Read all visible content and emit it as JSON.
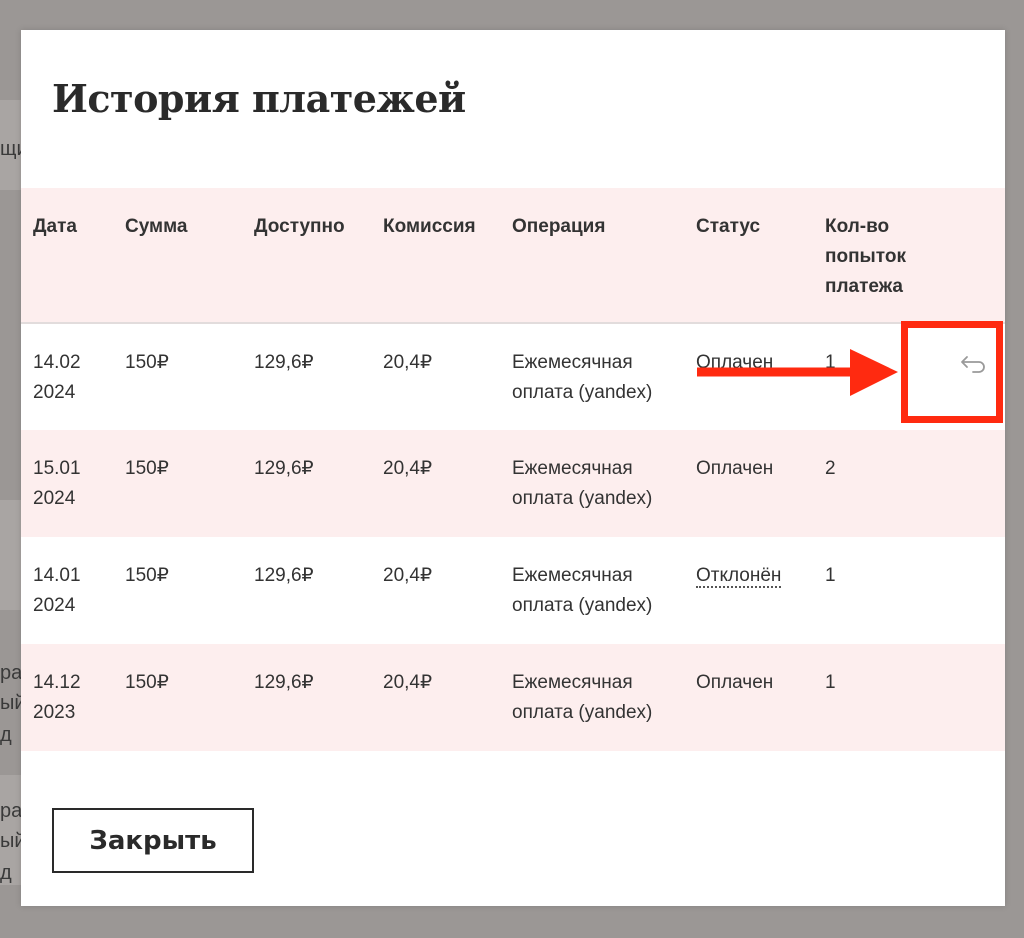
{
  "background": {
    "fragments": [
      "щи",
      "ра",
      "ый",
      "д",
      "ра",
      "ый",
      "д"
    ]
  },
  "modal": {
    "title": "История платежей",
    "close_label": "Закрыть"
  },
  "table": {
    "columns": [
      "Дата",
      "Сумма",
      "Доступно",
      "Комиссия",
      "Операция",
      "Статус",
      "Кол-во попыток платежа"
    ],
    "rows": [
      {
        "date": "14.02 2024",
        "amount": "150₽",
        "available": "129,6₽",
        "fee": "20,4₽",
        "operation": "Ежемесячная оплата (yandex)",
        "status": "Оплачен",
        "attempts": "1",
        "refund_icon": "undo-icon"
      },
      {
        "date": "15.01 2024",
        "amount": "150₽",
        "available": "129,6₽",
        "fee": "20,4₽",
        "operation": "Ежемесячная оплата (yandex)",
        "status": "Оплачен",
        "attempts": "2"
      },
      {
        "date": "14.01 2024",
        "amount": "150₽",
        "available": "129,6₽",
        "fee": "20,4₽",
        "operation": "Ежемесячная оплата (yandex)",
        "status": "Отклонён",
        "attempts": "1"
      },
      {
        "date": "14.12 2023",
        "amount": "150₽",
        "available": "129,6₽",
        "fee": "20,4₽",
        "operation": "Ежемесячная оплата (yandex)",
        "status": "Оплачен",
        "attempts": "1"
      }
    ]
  },
  "colors": {
    "header_bg": "#fdeeee",
    "annotation": "#ff2a10"
  }
}
